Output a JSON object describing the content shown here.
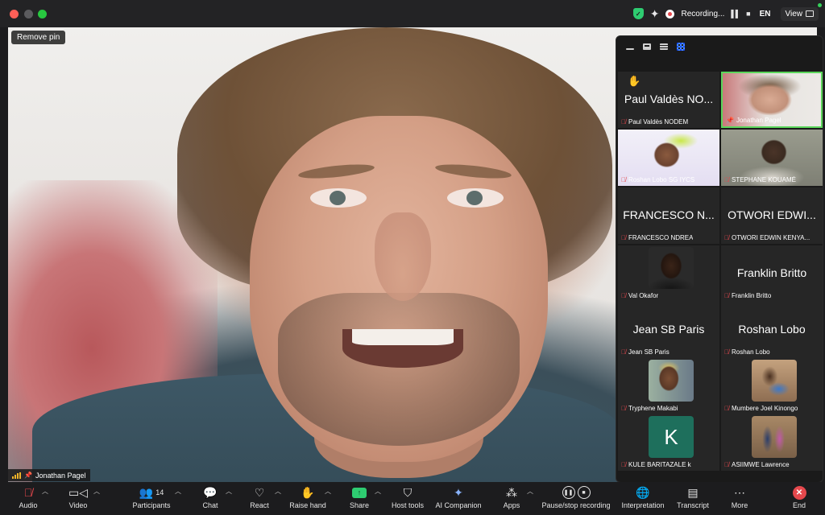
{
  "titlebar": {
    "recording_label": "Recording...",
    "pause_icon": "pause-icon",
    "stop_icon": "stop-icon",
    "language": "EN",
    "view_label": "View"
  },
  "main_video": {
    "remove_pin_label": "Remove pin",
    "participant_name": "Jonathan Pagel"
  },
  "panel": {
    "tiles": [
      {
        "display_name": "Paul Valdès NO...",
        "label": "Paul Valdès NODEM",
        "muted": true,
        "hand_raised": true
      },
      {
        "label": "Jonathan Pagel",
        "pinned": true,
        "active": true
      },
      {
        "label": "Roshan Lobo SG IYCS",
        "muted": true
      },
      {
        "label": "STEPHANE KOUAMÉ",
        "muted": true
      },
      {
        "display_name": "FRANCESCO N...",
        "label": "FRANCESCO NDREA",
        "muted": true
      },
      {
        "display_name": "OTWORI EDWI...",
        "label": "OTWORI EDWIN KENYA...",
        "muted": true
      },
      {
        "label": "Val Okafor",
        "muted": true
      },
      {
        "display_name": "Franklin Britto",
        "label": "Franklin Britto",
        "muted": true
      },
      {
        "display_name": "Jean SB Paris",
        "label": "Jean SB Paris",
        "muted": true
      },
      {
        "display_name": "Roshan Lobo",
        "label": "Roshan Lobo",
        "muted": true
      },
      {
        "label": "Tryphene Makabi",
        "muted": true
      },
      {
        "label": "Mumbere Joel Kinongo",
        "muted": true
      },
      {
        "avatar_letter": "K",
        "label": "KULE BARITAZALE k",
        "muted": true
      },
      {
        "label": "ASIIMWE Lawrence",
        "muted": true
      }
    ]
  },
  "toolbar": {
    "audio": "Audio",
    "video": "Video",
    "participants": "Participants",
    "participants_count": "14",
    "chat": "Chat",
    "react": "React",
    "raise_hand": "Raise hand",
    "share": "Share",
    "host_tools": "Host tools",
    "ai_companion": "AI Companion",
    "apps": "Apps",
    "pause_stop_recording": "Pause/stop recording",
    "interpretation": "Interpretation",
    "transcript": "Transcript",
    "more": "More",
    "end": "End"
  },
  "colors": {
    "end_red": "#e5484d",
    "share_green": "#2ecc71",
    "active_speaker_green": "#5bd65b",
    "panel_bg": "#1a1a1a",
    "toolbar_bg": "#1c1c1e"
  }
}
